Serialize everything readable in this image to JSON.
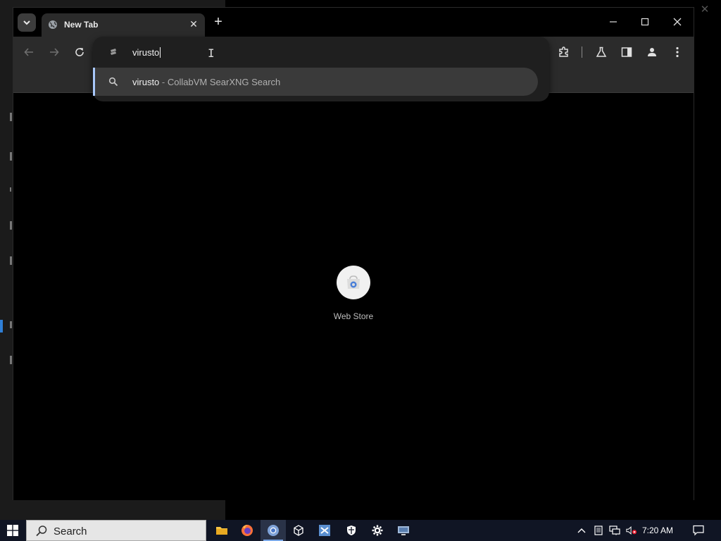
{
  "browser": {
    "tab": {
      "title": "New Tab"
    },
    "omnibox": {
      "typed_text": "virusto",
      "suggestion": {
        "query": "virusto",
        "separator": "-",
        "engine": "CollabVM SearXNG Search"
      }
    },
    "shortcut": {
      "label": "Web Store"
    }
  },
  "taskbar": {
    "search_placeholder": "Search",
    "clock": "7:20 AM",
    "apps": [
      "file-explorer-icon",
      "firefox-icon",
      "chrome-icon",
      "virtualbox-icon",
      "vm-manager-icon",
      "defender-icon",
      "settings-icon",
      "remote-desktop-icon"
    ]
  },
  "colors": {
    "taskbar": "#101524",
    "tab_active": "#2b2b2b",
    "suggestion_accent": "#a8c7fa",
    "windows_blue": "#0078d7"
  }
}
